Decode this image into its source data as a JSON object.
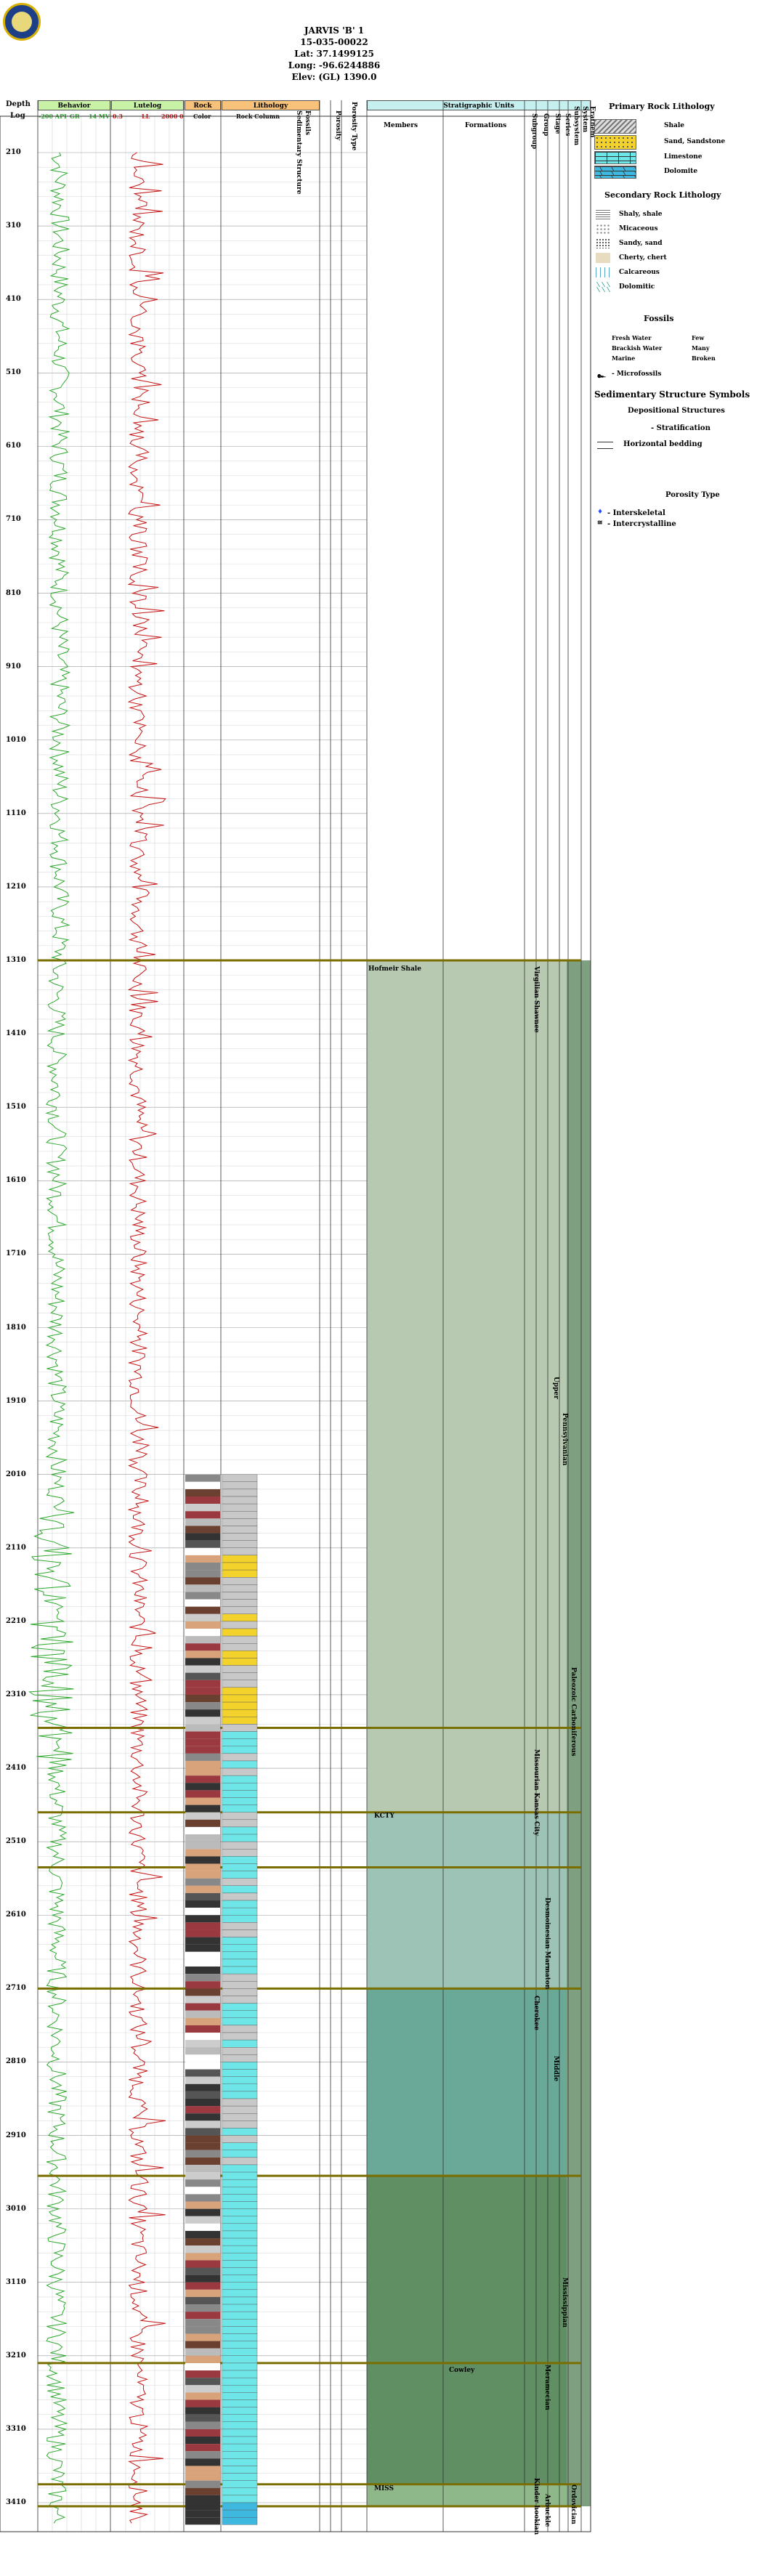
{
  "well": {
    "name": "JARVIS 'B' 1",
    "api": "15-035-00022",
    "lat": "Lat: 37.1499125",
    "long": "Long: -96.6244886",
    "elev": "Elev: (GL) 1390.0"
  },
  "columns": {
    "depth": "Depth",
    "log": "Log",
    "behavior": "Behavior",
    "behavior_sub": [
      "-200 API",
      "GR",
      "14 MV"
    ],
    "lutelog": "Lutelog",
    "lutelog_sub": [
      "0.3",
      "LL",
      "2000 0"
    ],
    "rock": "Rock",
    "rock_sub": "Color",
    "lithology": "Lithology",
    "lithology_sub": "Rock Column",
    "fossils": "Fossils",
    "sed_structure": "Sedimentary Structure",
    "porosity_type": "Porosity Type",
    "porosity": "Porosity",
    "strat_units": "Stratigraphic Units",
    "members": "Members",
    "formations": "Formations",
    "subgroup": "Subgroup",
    "group": "Group",
    "stage": "Stage",
    "series": "Series",
    "subsystem": "Subsystem",
    "system": "System",
    "erathem": "Erathem"
  },
  "depth_labels": [
    "210",
    "310",
    "410",
    "510",
    "610",
    "710",
    "810",
    "910",
    "1010",
    "1110",
    "1210",
    "1310",
    "1410",
    "1510",
    "1610",
    "1710",
    "1810",
    "1910",
    "2010",
    "2110",
    "2210",
    "2310",
    "2410",
    "2510",
    "2610",
    "2710",
    "2810",
    "2910",
    "3010",
    "3110",
    "3210",
    "3310",
    "3410"
  ],
  "strat_text": {
    "hofmeir": "Hofmeir Shale",
    "kcty": "KCTY",
    "mis": "MISS",
    "virgilian": "Virgilian Shawnee",
    "missourian": "Missourian Kansas City",
    "desmoinesian": "Desmoinesian Marmaton",
    "cherokee": "Cherokee",
    "upper": "Upper",
    "middle": "Middle",
    "pennsylvanian": "Pennsylvanian",
    "paleozoic": "Paleozoic Carboniferous",
    "mississippian_series": "Mississippian",
    "mississippian": "Meramecian",
    "cowley": "Cowley",
    "kinderhookian": "Kinder hookian",
    "arbuckle": "Arbuckle",
    "ordovician": "Ordovician"
  },
  "legend": {
    "primary_title": "Primary Rock Lithology",
    "primary": [
      "Shale",
      "Sand, Sandstone",
      "Limestone",
      "Dolomite"
    ],
    "secondary_title": "Secondary Rock Lithology",
    "secondary": [
      "Shaly, shale",
      "Micaceous",
      "Sandy, sand",
      "Cherty, chert",
      "Calcareous",
      "Dolomitic"
    ],
    "fossils_title": "Fossils",
    "fossils_left": [
      "Fresh Water",
      "Brackish Water",
      "Marine"
    ],
    "fossils_right": [
      "Few",
      "Many",
      "Broken"
    ],
    "microfossils": "- Microfossils",
    "sed_title": "Sedimentary Structure Symbols",
    "dep_title": "Depositional Structures",
    "strat_item": "- Stratification",
    "bedding": "Horizontal bedding",
    "porosity_title": "Porosity Type",
    "porosity": [
      "- Interskeletal",
      "- Intercrystalline"
    ]
  },
  "colors": {
    "gr_curve": "#2ea82e",
    "ll_curve": "#c41414",
    "penn_fill": "#b7c9b1",
    "kcty_fill": "#9cc3b5",
    "cherokee_fill": "#6aa898",
    "miss_fill": "#5f8f63",
    "header_green": "#c8f2a6",
    "header_orange": "#f8c27a",
    "header_cyan": "#c6f0f0",
    "sandstone": "#f2d22b",
    "limestone": "#6ee6e8",
    "dolomite": "#3fb8e0",
    "marker_line": "#7a6e00"
  }
}
